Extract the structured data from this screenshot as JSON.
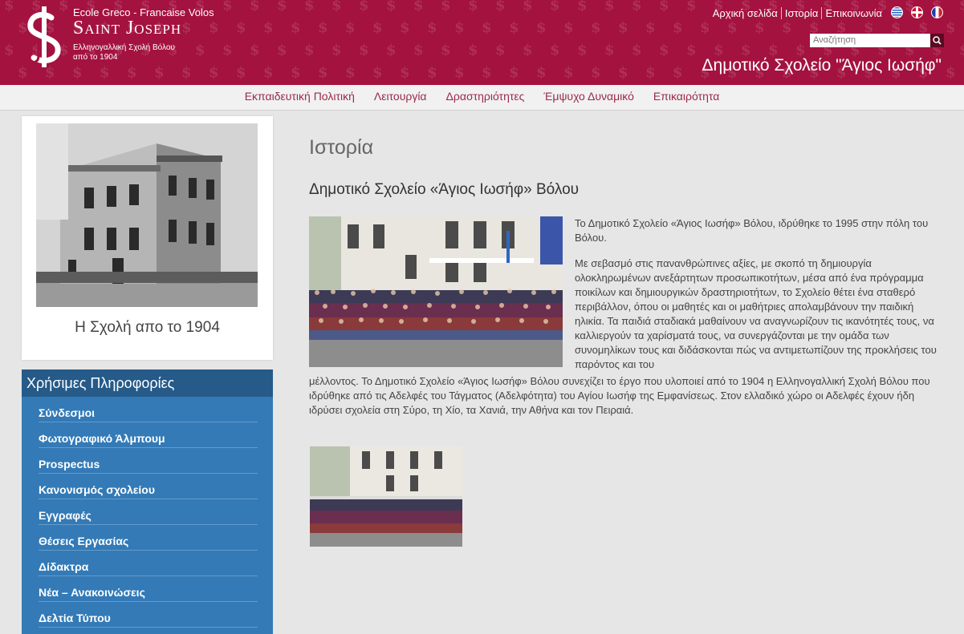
{
  "header": {
    "brand_line1": "Ecole Greco - Francaise Volos",
    "brand_line2": "Saint Joseph",
    "brand_line3a": "Ελληνογαλλική Σχολή Βόλου",
    "brand_line3b": "από το 1904",
    "topnav": [
      "Αρχική σελίδα",
      "Ιστορία",
      "Επικοινωνία"
    ],
    "search_placeholder": "Αναζήτηση",
    "school_title_prefix": "Δημοτικό Σχολείο ",
    "school_title_name": "\"Άγιος Ιωσήφ\"",
    "accent": "#a4123f"
  },
  "mainnav": [
    "Εκπαιδευτική Πολιτική",
    "Λειτουργία",
    "Δραστηριότητες",
    "Έμψυχο Δυναμικό",
    "Επικαιρότητα"
  ],
  "sidebar": {
    "photo_caption": "Η Σχολή απο το 1904",
    "info_title": "Χρήσιμες Πληροφορίες",
    "info_items": [
      "Σύνδεσμοι",
      "Φωτογραφικό Άλμπουμ",
      "Prospectus",
      "Κανονισμός σχολείου",
      "Εγγραφές",
      "Θέσεις Εργασίας",
      "Δίδακτρα",
      "Νέα – Ανακοινώσεις",
      "Δελτία Τύπου"
    ]
  },
  "content": {
    "page_title": "Ιστορία",
    "subtitle": "Δημοτικό Σχολείο «Άγιος Ιωσήφ» Βόλου",
    "para1": "Το Δημοτικό Σχολείο «Άγιος Ιωσήφ» Βόλου, ιδρύθηκε το 1995 στην πόλη του Βόλου.",
    "para2": "Με σεβασμό στις πανανθρώπινες αξίες, με σκοπό τη δημιουργία ολοκληρωμένων ανεξάρτητων προσωπικοτήτων, μέσα από ένα πρόγραμμα ποικίλων και δημιουργικών δραστηριοτήτων, το Σχολείο θέτει ένα σταθερό περιβάλλον, όπου οι μαθητές και οι μαθήτριες απολαμβάνουν την παιδική ηλικία. Τα παιδιά σταδιακά μαθαίνουν να αναγνωρίζουν τις ικανότητές τους, να καλλιεργούν τα χαρίσματά τους, να συνεργάζονται με την ομάδα των συνομηλίκων τους και διδάσκονται πώς να αντιμετωπίζουν της προκλήσεις του παρόντος και του",
    "para2_cont": "μέλλοντος. Το Δημοτικό Σχολείο «Άγιος Ιωσήφ» Βόλου συνεχίζει το έργο που υλοποιεί από το 1904 η Ελληνογαλλική Σχολή Βόλου που ιδρύθηκε από τις Αδελφές του Τάγματος (Αδελφότητα) του Αγίου Ιωσήφ της Εμφανίσεως. Στον ελλαδικό χώρο οι Αδελφές έχουν ήδη ιδρύσει σχολεία στη Σύρο, τη Χίο, τα Χανιά, την Αθήνα και τον Πειραιά."
  }
}
